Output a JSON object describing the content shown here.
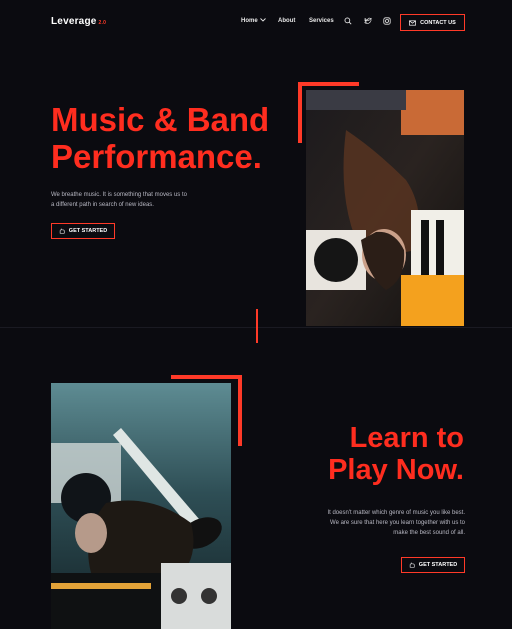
{
  "header": {
    "logo_text": "Leverage",
    "logo_version": "2.0",
    "nav_items": [
      "Home",
      "About",
      "Services"
    ],
    "contact_label": "CONTACT US",
    "icons": [
      "search-icon",
      "twitter-icon",
      "instagram-icon"
    ]
  },
  "hero": {
    "title_line1": "Music & Band",
    "title_line2": "Performance.",
    "description_line1": "We breathe music. It is something that moves us to",
    "description_line2": "a different path in search of new ideas.",
    "cta_label": "GET STARTED"
  },
  "section2": {
    "title_line1": "Learn to",
    "title_line2": "Play Now.",
    "description_line1": "It doesn't matter which genre of music you like best.",
    "description_line2": "We are sure that here you learn together with us to",
    "description_line3": "make the best sound of all.",
    "cta_label": "GET STARTED"
  },
  "colors": {
    "accent": "#ff3a28",
    "background": "#0b0b10"
  }
}
